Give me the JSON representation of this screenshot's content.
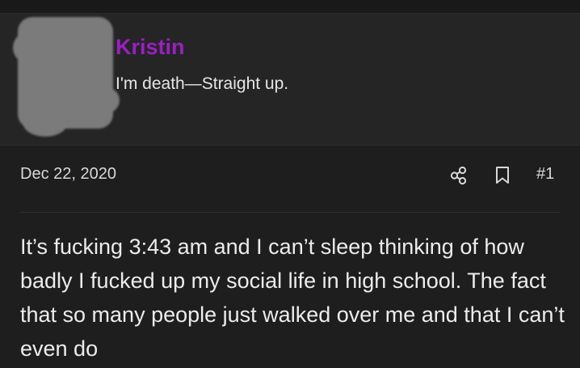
{
  "user": {
    "name": "Kristin",
    "title": "I'm death—Straight up."
  },
  "post": {
    "date": "Dec 22, 2020",
    "number": "#1",
    "body": "It’s fucking 3:43 am and I can’t sleep thinking of how badly I fucked up my social life in high school. The fact that so many people just walked over me and that I can’t even do"
  },
  "icons": {
    "share": "share-icon",
    "bookmark": "bookmark-icon"
  },
  "colors": {
    "background": "#1e1e1f",
    "panel": "#252526",
    "username": "#9b1fc2",
    "text": "#ececec"
  }
}
